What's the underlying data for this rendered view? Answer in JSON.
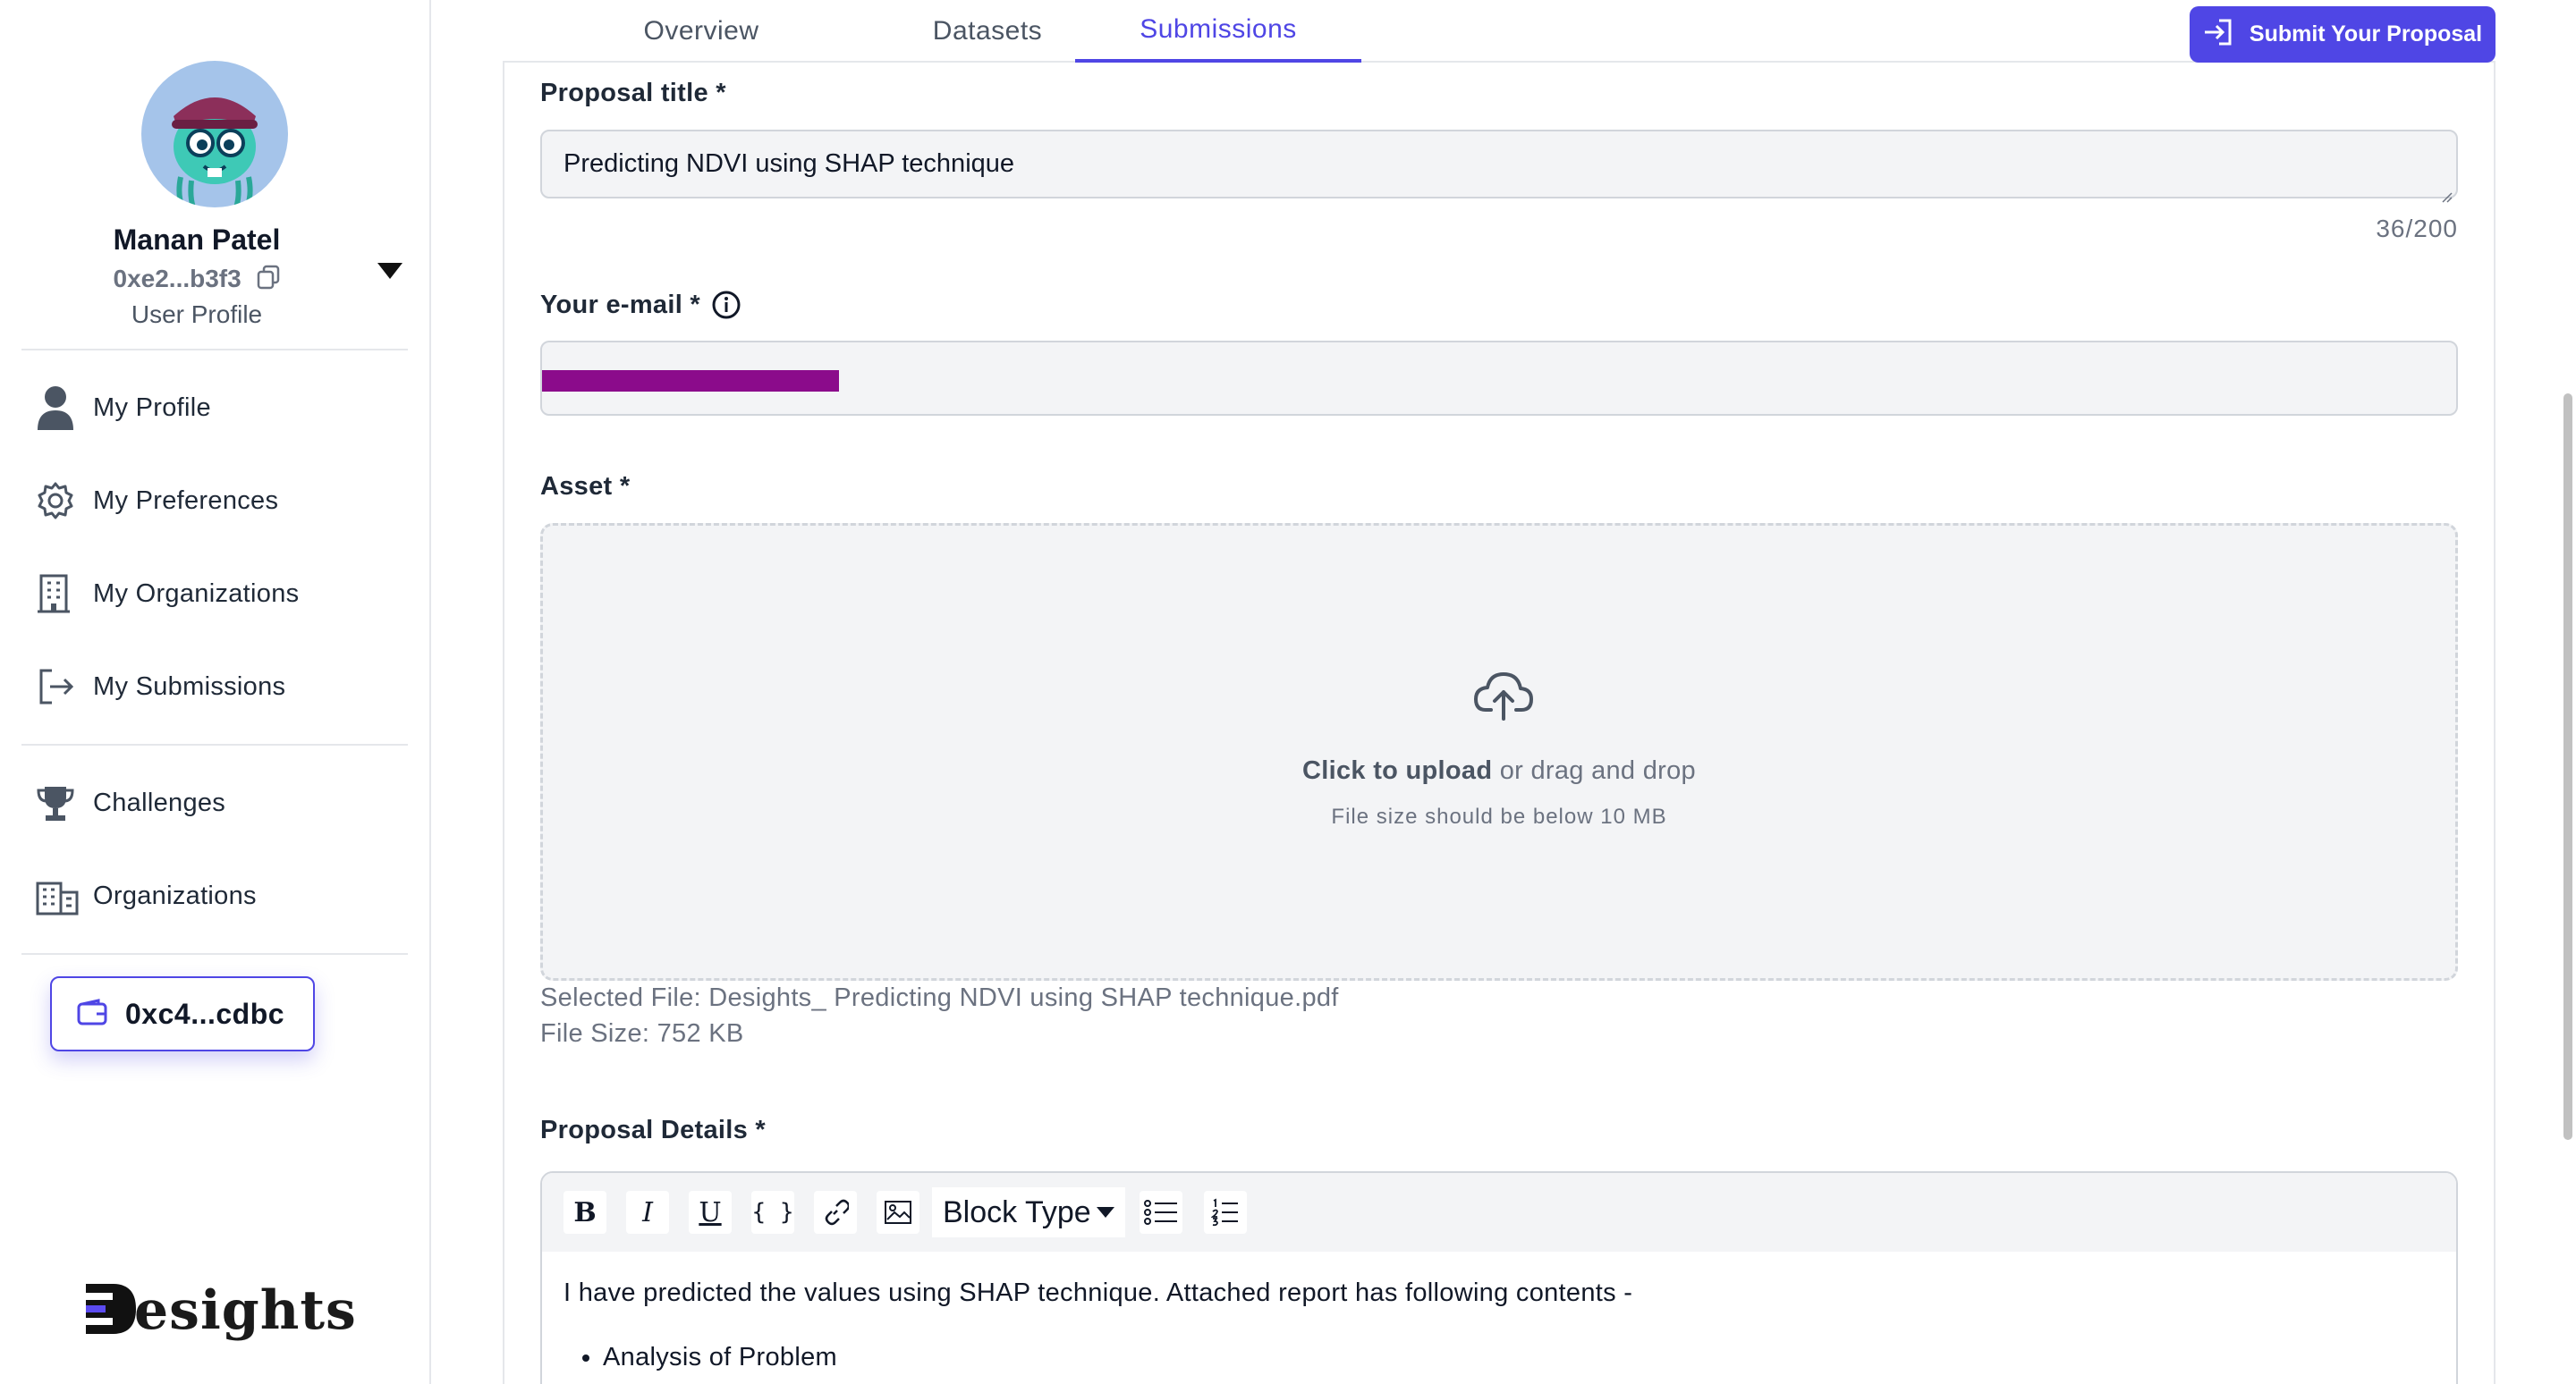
{
  "sidebar": {
    "user_name": "Manan Patel",
    "user_address": "0xe2...b3f3",
    "user_profile_label": "User Profile",
    "nav_items": [
      {
        "label": "My Profile",
        "icon": "person-icon"
      },
      {
        "label": "My Preferences",
        "icon": "gear-icon"
      },
      {
        "label": "My Organizations",
        "icon": "building-icon"
      },
      {
        "label": "My Submissions",
        "icon": "logout-icon"
      }
    ],
    "secondary_items": [
      {
        "label": "Challenges",
        "icon": "trophy-icon"
      },
      {
        "label": "Organizations",
        "icon": "city-icon"
      }
    ],
    "wallet_label": "0xc4...cdbc",
    "brand": "esights"
  },
  "tabs": [
    {
      "label": "Overview",
      "active": false
    },
    {
      "label": "Datasets",
      "active": false
    },
    {
      "label": "Submissions",
      "active": true
    }
  ],
  "submit_button_label": "Submit Your Proposal",
  "form": {
    "title_label": "Proposal title *",
    "title_value": "Predicting NDVI using SHAP technique",
    "title_counter": "36/200",
    "email_label": "Your e-mail *",
    "asset_label": "Asset *",
    "upload_click": "Click to upload",
    "upload_rest": " or drag and drop",
    "upload_hint": "File size should be below 10 MB",
    "selected_file": "Selected File: Desights_ Predicting NDVI using SHAP technique.pdf",
    "file_size": "File Size: 752 KB",
    "details_label": "Proposal Details *"
  },
  "editor": {
    "block_type_label": "Block Type",
    "bold_glyph": "B",
    "italic_glyph": "I",
    "underline_glyph": "U",
    "code_glyph": "{ }",
    "paragraph": "I have predicted the values using SHAP technique. Attached report has following contents -",
    "bullets": [
      "Analysis of Problem"
    ]
  },
  "colors": {
    "accent": "#4f46e5",
    "redaction": "#8b0b8b",
    "field_bg": "#f3f4f6"
  }
}
